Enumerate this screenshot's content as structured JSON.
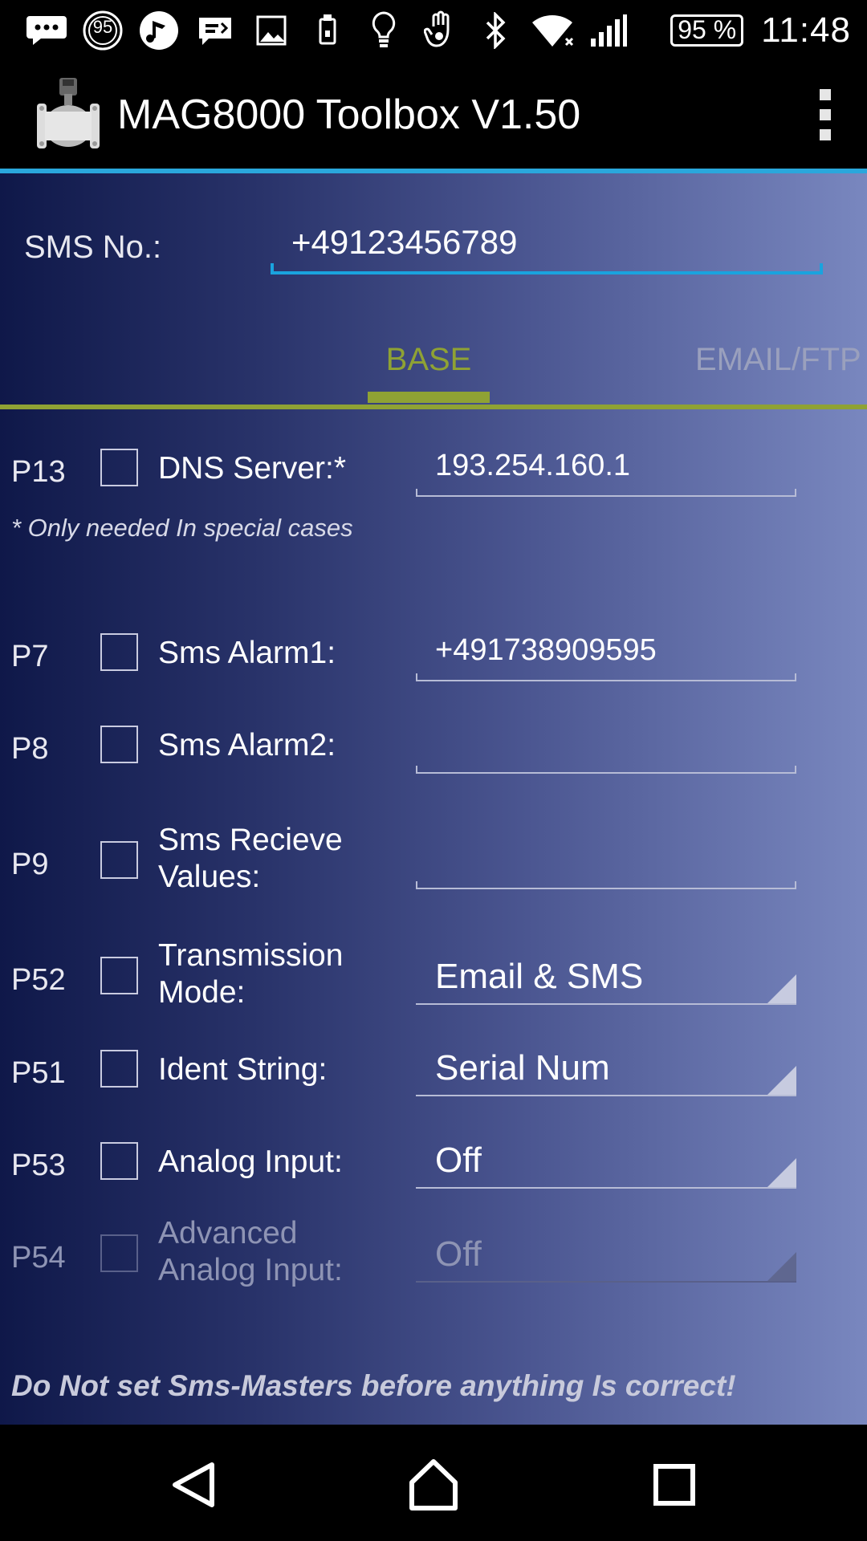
{
  "status_bar": {
    "icons": [
      "message-icon",
      "notification-95-icon",
      "music-icon",
      "sms-icon",
      "image-icon",
      "phone-icon",
      "lightbulb-icon",
      "hand-icon",
      "bluetooth-icon",
      "wifi-icon",
      "signal-icon"
    ],
    "notification_badge": "95",
    "battery": "95 %",
    "time": "11:48"
  },
  "action_bar": {
    "title": "MAG8000 Toolbox V1.50"
  },
  "sms": {
    "label": "SMS No.:",
    "value": "+49123456789"
  },
  "tabs": {
    "active": "BASE",
    "next": "EMAIL/FTP"
  },
  "rows": [
    {
      "param": "P13",
      "label": "DNS Server:*",
      "value": "193.254.160.1"
    },
    {
      "param": "P7",
      "label": "Sms Alarm1:",
      "value": "+491738909595"
    },
    {
      "param": "P8",
      "label": "Sms Alarm2:",
      "value": ""
    },
    {
      "param": "P9",
      "label": "Sms Recieve Values:",
      "value": ""
    },
    {
      "param": "P52",
      "label": "Transmission Mode:",
      "value": "Email & SMS"
    },
    {
      "param": "P51",
      "label": "Ident String:",
      "value": "Serial Num"
    },
    {
      "param": "P53",
      "label": "Analog Input:",
      "value": "Off"
    },
    {
      "param": "P54",
      "label": "Advanced Analog Input:",
      "value": "Off"
    }
  ],
  "note": "* Only needed In special cases",
  "warning": "Do Not set Sms-Masters before anything Is correct!",
  "colors": {
    "accent_blue": "#1aa3de",
    "tab_green": "#8fa234"
  }
}
